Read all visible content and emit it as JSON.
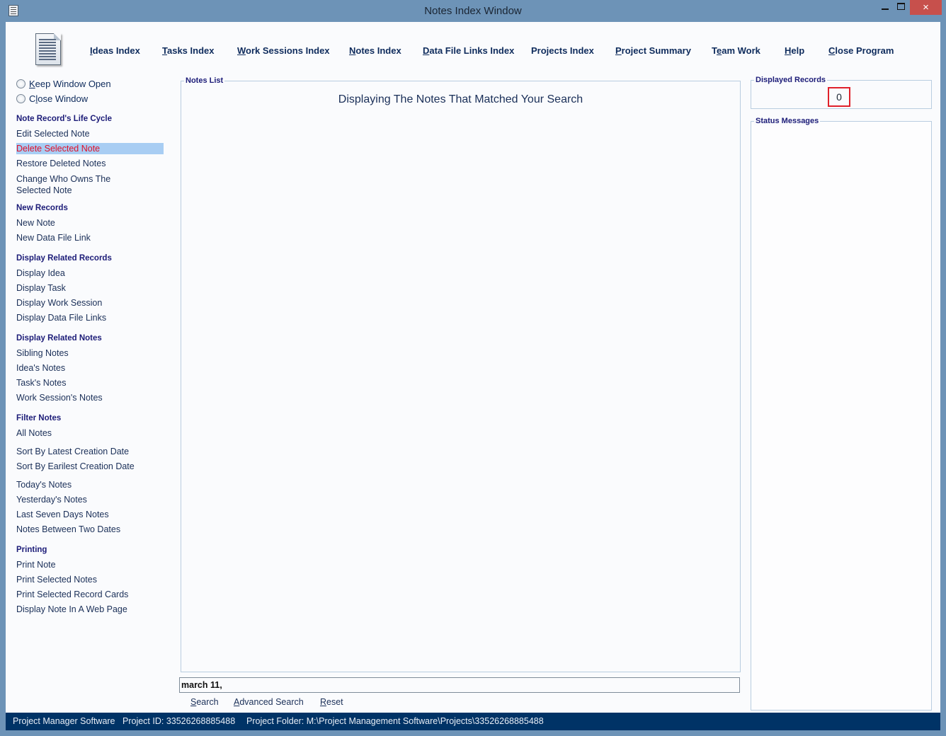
{
  "window": {
    "title": "Notes Index Window",
    "controls": {
      "minimize": "minimize",
      "maximize": "maximize",
      "close": "×"
    }
  },
  "menubar": {
    "items": [
      {
        "label": "Ideas Index",
        "mnemonic": "I",
        "rest": "deas Index"
      },
      {
        "label": "Tasks Index",
        "mnemonic": "T",
        "rest": "asks Index"
      },
      {
        "label": "Work Sessions Index",
        "mnemonic": "W",
        "rest": "ork Sessions Index"
      },
      {
        "label": "Notes Index",
        "mnemonic": "N",
        "rest": "otes Index"
      },
      {
        "label": "Data File Links Index",
        "mnemonic": "D",
        "rest": "ata File Links Index"
      },
      {
        "label": "Projects Index",
        "mnemonic": "",
        "rest": "Projects Index"
      },
      {
        "label": "Project Summary",
        "mnemonic": "P",
        "rest": "roject Summary"
      },
      {
        "label": "Team Work",
        "pre": "T",
        "mnemonic": "e",
        "rest": "am Work"
      },
      {
        "label": "Help",
        "mnemonic": "H",
        "rest": "elp"
      },
      {
        "label": "Close Program",
        "mnemonic": "C",
        "rest": "lose Program"
      }
    ]
  },
  "sidebar": {
    "radios": [
      {
        "label": "Keep Window Open",
        "mnemonic": "K",
        "rest": "eep Window Open",
        "checked": false
      },
      {
        "pre": "C",
        "mnemonic": "l",
        "rest": "ose Window",
        "label": "Close Window",
        "checked": false
      }
    ],
    "sections": [
      {
        "heading": "Note Record's Life Cycle",
        "items": [
          "Edit Selected Note",
          "Delete Selected Note",
          "Restore Deleted Notes",
          "Change Who Owns The Selected Note"
        ]
      },
      {
        "heading": "New Records",
        "items": [
          "New Note",
          "New Data File Link"
        ]
      },
      {
        "heading": "Display Related Records",
        "items": [
          "Display Idea",
          "Display Task",
          "Display Work Session",
          "Display Data File Links"
        ]
      },
      {
        "heading": "Display Related Notes",
        "items": [
          "Sibling Notes",
          "Idea's Notes",
          "Task's Notes",
          "Work Session's Notes"
        ]
      },
      {
        "heading": "Filter Notes",
        "items": [
          "All Notes",
          "Sort By Latest Creation Date",
          "Sort By Earilest Creation Date",
          "Today's Notes",
          "Yesterday's Notes",
          "Last Seven Days Notes",
          "Notes Between Two Dates"
        ]
      },
      {
        "heading": "Printing",
        "items": [
          "Print Note",
          "Print Selected Notes",
          "Print Selected Record Cards",
          "Display Note In A Web Page"
        ]
      }
    ],
    "change_owner_line1": "Change Who Owns The",
    "change_owner_line2": "Selected Note",
    "selected_item": "Delete Selected Note"
  },
  "notes_list": {
    "legend": "Notes List",
    "heading": "Displaying The Notes That Matched Your Search"
  },
  "displayed_records": {
    "legend": "Displayed Records",
    "count": "0"
  },
  "status_messages": {
    "legend": "Status Messages"
  },
  "search": {
    "value": "march 11,",
    "buttons": [
      {
        "label": "Search",
        "mnemonic": "S",
        "rest": "earch"
      },
      {
        "label": "Advanced Search",
        "mnemonic": "A",
        "rest": "dvanced Search"
      },
      {
        "label": "Reset",
        "mnemonic": "R",
        "rest": "eset"
      }
    ]
  },
  "statusbar": {
    "app": "Project Manager Software",
    "project_id": "Project ID:  33526268885488",
    "project_folder": "Project Folder: M:\\Project Management Software\\Projects\\33526268885488"
  },
  "colors": {
    "frame": "#6d93b7",
    "statusbar": "#003366",
    "selected_bg": "#a8cdf3",
    "selected_text": "#e0102a",
    "count_border": "#e0202a",
    "close_button": "#c7504c"
  }
}
